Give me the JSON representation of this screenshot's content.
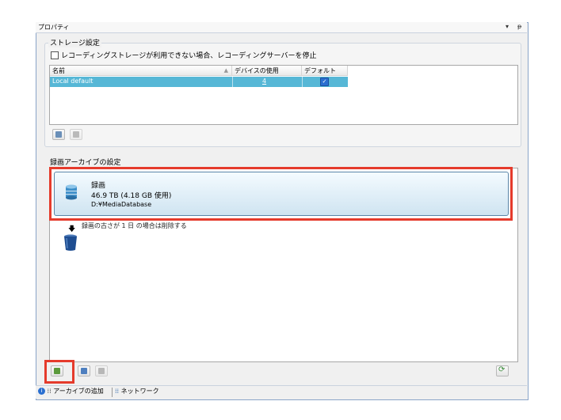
{
  "window": {
    "title": "プロパティ",
    "pin_glyph": "▾",
    "close_glyph": "ᵽ"
  },
  "storage": {
    "section_title": "ストレージ設定",
    "stop_checkbox_label": "レコーディングストレージが利用できない場合、レコーディングサーバーを停止",
    "stop_checkbox_checked": false,
    "columns": [
      "名前",
      "デバイスの使用",
      "デフォルト"
    ],
    "rows": [
      {
        "name": "Local default",
        "devices": "4",
        "default": true
      }
    ],
    "selected_row_color": "#56b7d6"
  },
  "archive": {
    "section_title": "録画アーカイブの設定",
    "recording": {
      "title": "録画",
      "size": "46.9 TB (4.18 GB 使用)",
      "path": "D:¥MediaDatabase"
    },
    "delete_rule": "録画の古さが 1 日 の場合は削除する"
  },
  "tabs": [
    {
      "label": "アーカイブの追加",
      "icon": "info-icon"
    },
    {
      "label": "ネットワーク",
      "icon": "network-icon"
    }
  ],
  "colors": {
    "highlight": "#e53b2c",
    "accent": "#2a6fd0"
  }
}
